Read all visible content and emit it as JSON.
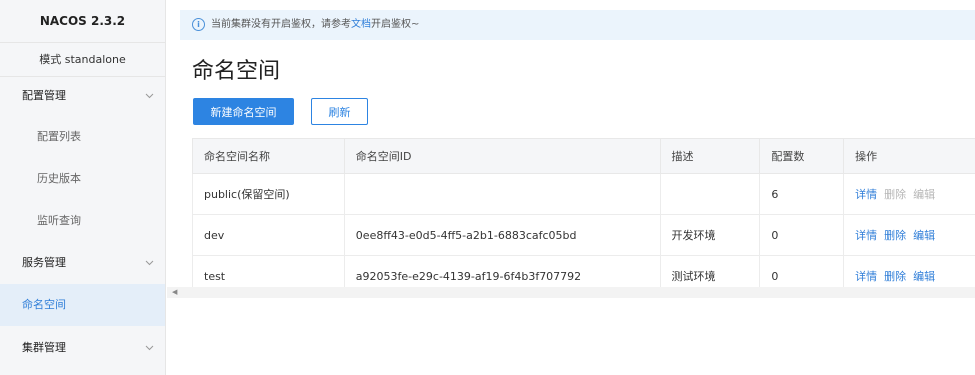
{
  "sidebar": {
    "title": "NACOS 2.3.2",
    "mode": "模式 standalone",
    "config_group": "配置管理",
    "config_items": [
      "配置列表",
      "历史版本",
      "监听查询"
    ],
    "service_group": "服务管理",
    "namespace_item": "命名空间",
    "cluster_group": "集群管理"
  },
  "notice": {
    "text_before": "当前集群没有开启鉴权，请参考",
    "link": "文档",
    "text_after": "开启鉴权~"
  },
  "main": {
    "title": "命名空间",
    "new_button": "新建命名空间",
    "refresh_button": "刷新"
  },
  "table": {
    "columns": [
      "命名空间名称",
      "命名空间ID",
      "描述",
      "配置数",
      "操作"
    ],
    "rows": [
      {
        "name": "public(保留空间)",
        "id": "",
        "desc": "",
        "count": "6"
      },
      {
        "name": "dev",
        "id": "0ee8ff43-e0d5-4ff5-a2b1-6883cafc05bd",
        "desc": "开发环境",
        "count": "0"
      },
      {
        "name": "test",
        "id": "a92053fe-e29c-4139-af19-6f4b3f707792",
        "desc": "测试环境",
        "count": "0"
      }
    ],
    "actions": {
      "detail": "详情",
      "delete": "删除",
      "edit": "编辑"
    }
  },
  "colors": {
    "accent": "#2d84e2",
    "notice_bg": "#ebf4fc",
    "active_bg": "#e4eef9"
  }
}
